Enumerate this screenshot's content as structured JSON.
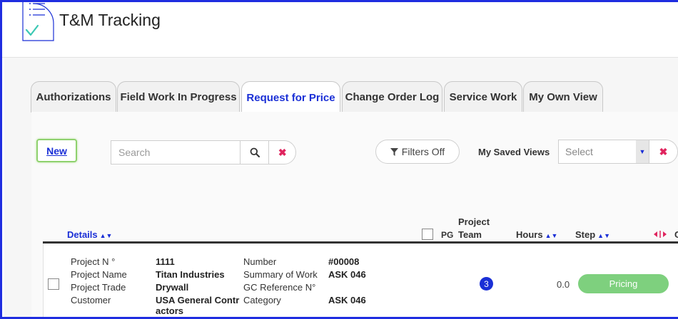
{
  "header": {
    "title": "T&M Tracking"
  },
  "tabs": [
    {
      "label": "Authorizations"
    },
    {
      "label": "Field Work In Progress"
    },
    {
      "label": "Request for Price"
    },
    {
      "label": "Change Order Log"
    },
    {
      "label": "Service Work"
    },
    {
      "label": "My Own View"
    }
  ],
  "toolbar": {
    "new_label": "New",
    "search_placeholder": "Search",
    "filters_label": "Filters Off",
    "saved_views_label": "My Saved Views",
    "select_value": "Select"
  },
  "table": {
    "headers": {
      "details": "Details",
      "pg": "PG",
      "project_team_line1": "Project",
      "project_team_line2": "Team",
      "hours": "Hours",
      "step": "Step",
      "cut": "C"
    },
    "row": {
      "project_no_label": "Project N °",
      "project_no": "1111",
      "project_name_label": "Project Name",
      "project_name": "Titan Industries",
      "project_trade_label": "Project Trade",
      "project_trade": "Drywall",
      "customer_label": "Customer",
      "customer_line1": "USA General Contr",
      "customer_line2": "actors",
      "number_label": "Number",
      "number": "#00008",
      "summary_label": "Summary of Work",
      "summary": "ASK 046",
      "gc_ref_label": "GC Reference N°",
      "gc_ref": "",
      "category_label": "Category",
      "category": "ASK 046",
      "team_count": "3",
      "hours": "0.0",
      "step": "Pricing"
    }
  },
  "colors": {
    "accent": "#1a2fd6",
    "step_pill": "#7ed07e",
    "clear": "#e0245e",
    "frame": "#1f2de0"
  }
}
